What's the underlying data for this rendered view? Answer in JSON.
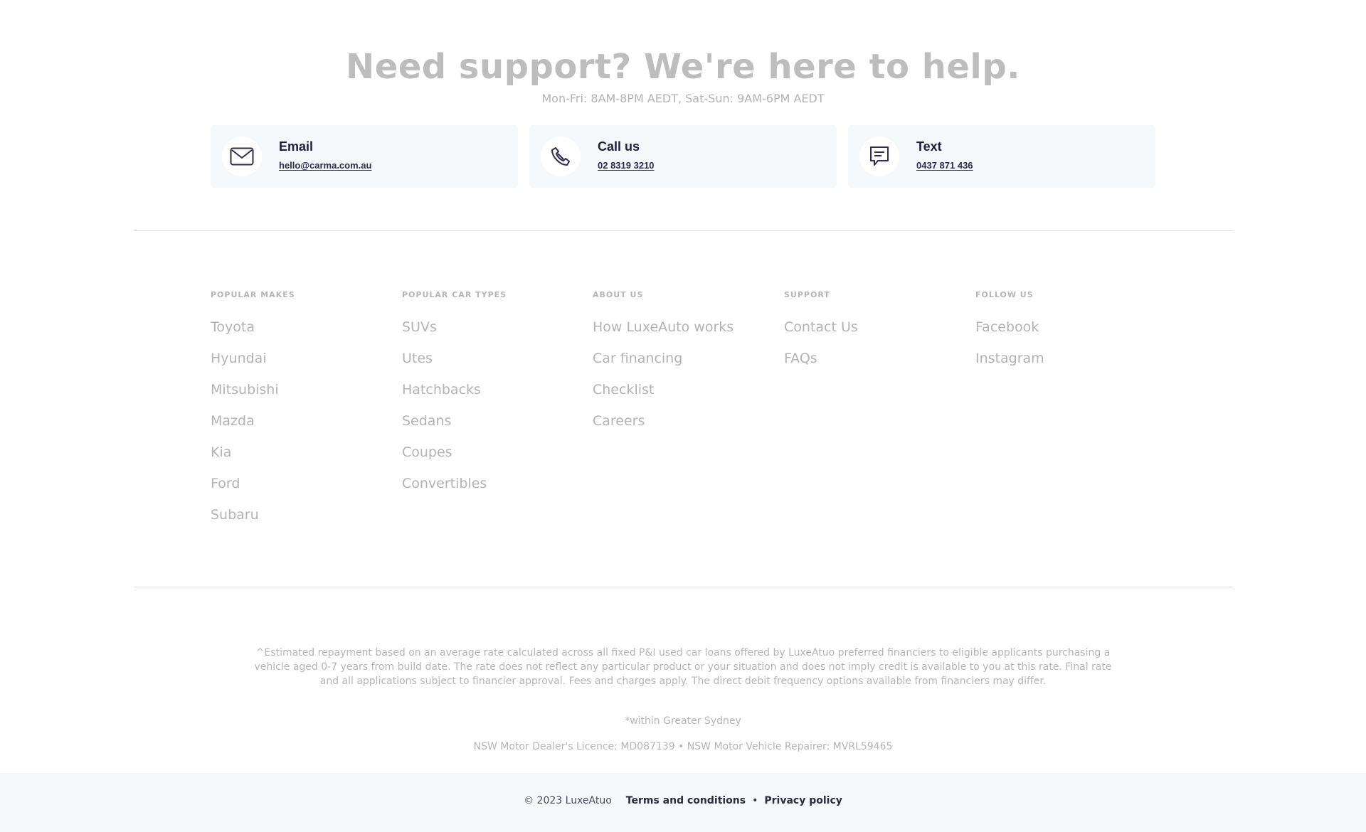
{
  "support": {
    "title": "Need support? We're here to help.",
    "hours": "Mon-Fri: 8AM-8PM AEDT, Sat-Sun: 9AM-6PM AEDT",
    "cards": [
      {
        "label": "Email",
        "value": "hello@carma.com.au",
        "icon": "mail-icon"
      },
      {
        "label": "Call us",
        "value": "02 8319 3210",
        "icon": "phone-icon"
      },
      {
        "label": "Text",
        "value": "0437 871 436",
        "icon": "chat-icon"
      }
    ]
  },
  "footer": {
    "columns": [
      {
        "heading": "POPULAR MAKES",
        "links": [
          "Toyota",
          "Hyundai",
          "Mitsubishi",
          "Mazda",
          "Kia",
          "Ford",
          "Subaru"
        ]
      },
      {
        "heading": "POPULAR CAR TYPES",
        "links": [
          "SUVs",
          "Utes",
          "Hatchbacks",
          "Sedans",
          "Coupes",
          "Convertibles"
        ]
      },
      {
        "heading": "ABOUT US",
        "links": [
          "How LuxeAuto works",
          "Car financing",
          "Checklist",
          "Careers"
        ]
      },
      {
        "heading": "SUPPORT",
        "links": [
          "Contact Us",
          "FAQs"
        ]
      },
      {
        "heading": "FOLLOW US",
        "links": [
          "Facebook",
          "Instagram"
        ]
      }
    ]
  },
  "legal": {
    "disclaimer": "^Estimated repayment based on an average rate calculated across all fixed P&I used car loans offered by LuxeAtuo preferred financiers to eligible applicants purchasing a vehicle aged 0-7 years from build date. The rate does not reflect any particular product or your situation and does not imply credit is available to you at this rate. Final rate and all applications subject to financier approval. Fees and charges apply. The direct debit frequency options available from financiers may differ.",
    "sydney_note": "*within Greater Sydney",
    "licence": "NSW Motor Dealer's Licence: MD087139 • NSW Motor Vehicle Repairer: MVRL59465"
  },
  "bottom_bar": {
    "copyright": "© 2023 LuxeAtuo",
    "terms": "Terms and conditions",
    "separator": "•",
    "privacy": "Privacy policy"
  },
  "colors": {
    "card_bg": "#f6f9fc",
    "icon_stroke": "#2d2b52",
    "muted_text": "#b3b3b3"
  }
}
